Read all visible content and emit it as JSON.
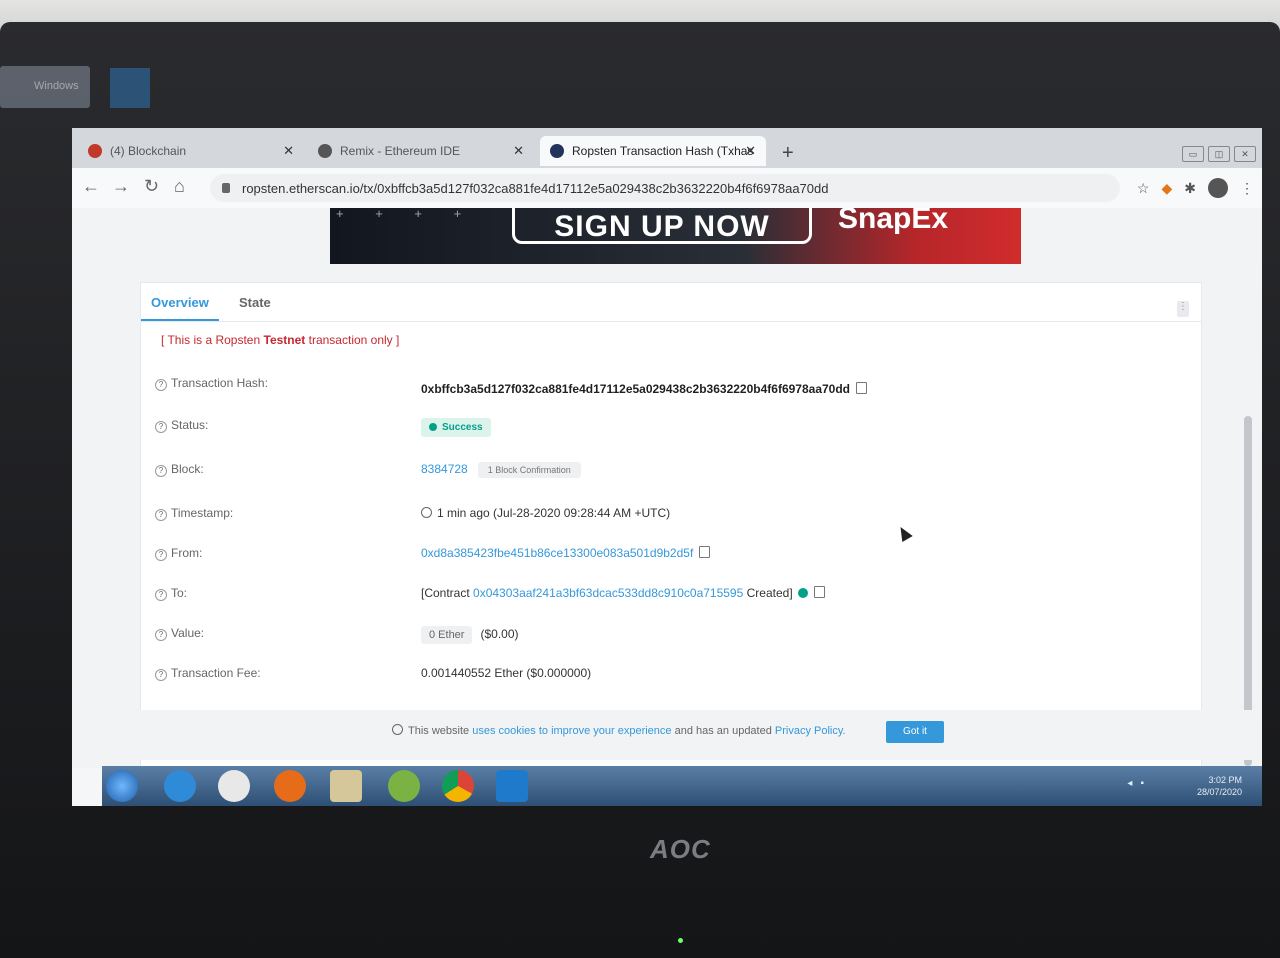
{
  "desktop": {
    "icon_label": "Windows"
  },
  "browser": {
    "tabs": [
      {
        "label": "(4) Blockchain",
        "active": false
      },
      {
        "label": "Remix - Ethereum IDE",
        "active": false
      },
      {
        "label": "Ropsten Transaction Hash (Txhas",
        "active": true
      }
    ],
    "new_tab": "+",
    "url": "ropsten.etherscan.io/tx/0xbffcb3a5d127f032ca881fe4d17112e5a029438c2b3632220b4f6f6978aa70dd"
  },
  "banner": {
    "cta": "SIGN UP NOW",
    "brand": "SnapEx"
  },
  "page": {
    "tabs": [
      "Overview",
      "State"
    ],
    "notice_prefix": "[ This is a Ropsten ",
    "notice_bold": "Testnet",
    "notice_suffix": " transaction only ]",
    "rows": {
      "hash_label": "Transaction Hash:",
      "hash_value": "0xbffcb3a5d127f032ca881fe4d17112e5a029438c2b3632220b4f6f6978aa70dd",
      "status_label": "Status:",
      "status_value": "Success",
      "block_label": "Block:",
      "block_value": "8384728",
      "block_confirmations": "1 Block Confirmation",
      "timestamp_label": "Timestamp:",
      "timestamp_value": "1 min ago (Jul-28-2020 09:28:44 AM +UTC)",
      "from_label": "From:",
      "from_value": "0xd8a385423fbe451b86ce13300e083a501d9b2d5f",
      "to_label": "To:",
      "to_prefix": "[Contract ",
      "to_value": "0x04303aaf241a3bf63dcac533dd8c910c0a715595",
      "to_suffix": " Created]",
      "value_label": "Value:",
      "value_ether": "0 Ether",
      "value_usd": "($0.00)",
      "fee_label": "Transaction Fee:",
      "fee_value": "0.001440552 Ether ($0.000000)"
    },
    "cookie_prefix": "This website ",
    "cookie_link1": "uses cookies to improve your experience",
    "cookie_mid": " and has an updated ",
    "cookie_link2": "Privacy Policy.",
    "cookie_button": "Got it"
  },
  "taskbar": {
    "time": "3:02 PM",
    "date": "28/07/2020"
  },
  "monitor": {
    "brand": "AOC"
  },
  "colors": {
    "accent": "#3498db",
    "success": "#00a186",
    "notice": "#c5282f",
    "taskbar": "#3f6690"
  }
}
